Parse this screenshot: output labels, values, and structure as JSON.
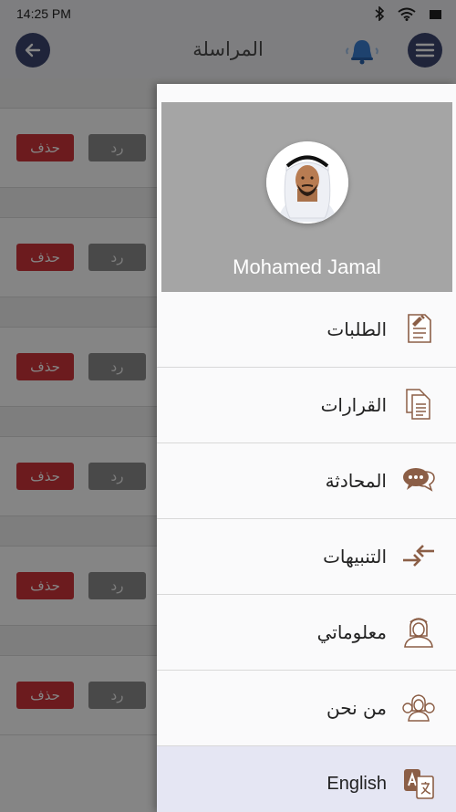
{
  "status_bar": {
    "time": "14:25 PM"
  },
  "app_bar": {
    "title": "المراسلة"
  },
  "messages": {
    "delete_label": "حذف",
    "reply_label": "رد",
    "row_count": 6
  },
  "drawer": {
    "user_name": "Mohamed Jamal",
    "items": [
      {
        "label": "الطلبات",
        "icon": "requests-document-icon"
      },
      {
        "label": "القرارات",
        "icon": "decisions-documents-icon"
      },
      {
        "label": "المحادثة",
        "icon": "chat-bubbles-icon"
      },
      {
        "label": "التنبيهات",
        "icon": "alerts-arrows-icon"
      },
      {
        "label": "معلوماتي",
        "icon": "profile-person-icon"
      },
      {
        "label": "من نحن",
        "icon": "about-us-icon"
      },
      {
        "label": "English",
        "icon": "language-translate-icon"
      }
    ]
  },
  "colors": {
    "accent": "#3d4670",
    "delete": "#d0343a",
    "icon_brown": "#8b5e46",
    "highlight": "#e5e6f3"
  }
}
